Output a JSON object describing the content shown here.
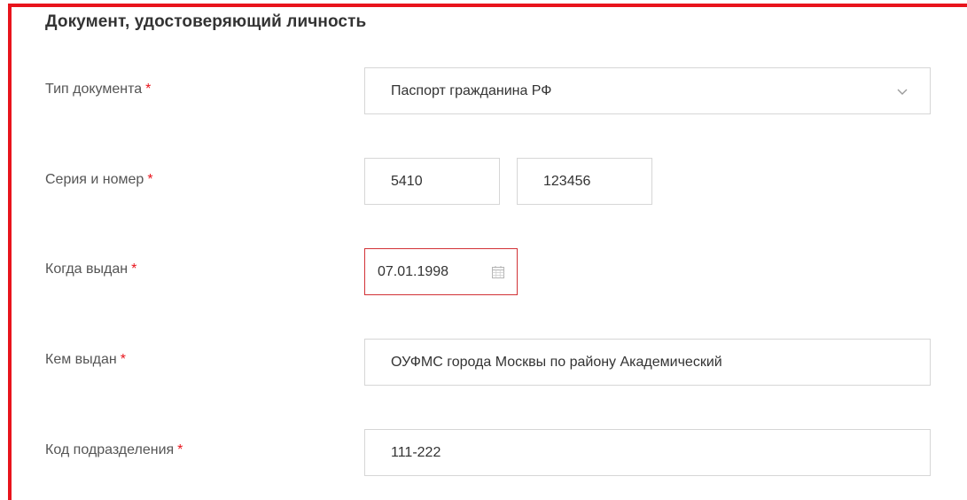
{
  "form": {
    "section_title": "Документ, удостоверяющий личность",
    "required_mark": "*",
    "doc_type": {
      "label": "Тип документа",
      "value": "Паспорт гражданина РФ"
    },
    "series_number": {
      "label": "Серия и номер",
      "series": "5410",
      "number": "123456"
    },
    "issue_date": {
      "label": "Когда выдан",
      "value": "07.01.1998"
    },
    "issued_by": {
      "label": "Кем выдан",
      "value": "ОУФМС города Москвы по району Академический"
    },
    "dept_code": {
      "label": "Код подразделения",
      "value": "111-222"
    }
  },
  "icons": {
    "select": "chevron-down-icon",
    "date": "calendar-icon"
  },
  "colors": {
    "highlight_frame": "#e8141c",
    "required": "#e8141c",
    "error_border": "#d23236",
    "field_border": "#d6d6d6",
    "label_text": "#555555",
    "value_text": "#333333"
  }
}
